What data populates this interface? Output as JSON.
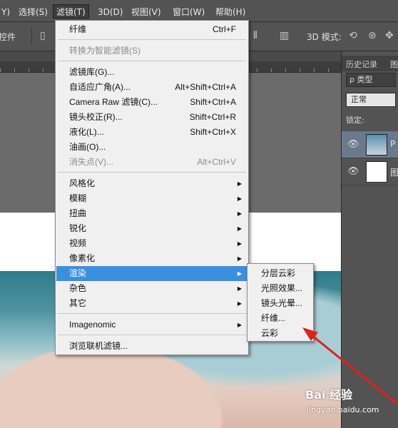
{
  "menubar": {
    "items": [
      "Y)",
      "选择(S)",
      "滤镜(T)",
      "3D(D)",
      "视图(V)",
      "窗口(W)",
      "帮助(H)"
    ]
  },
  "optbar": {
    "controls_label": "控件",
    "mode_3d": "3D 模式:"
  },
  "panel": {
    "tabs": [
      "历史记录",
      "图"
    ],
    "kind": "ρ 类型",
    "blend": "正常",
    "lock": "锁定:",
    "layers": [
      "P",
      "图"
    ]
  },
  "menu": {
    "items": [
      {
        "label": "纤维",
        "shortcut": "Ctrl+F"
      },
      {
        "label": "转换为智能滤镜(S)"
      },
      {
        "label": "滤镜库(G)..."
      },
      {
        "label": "自适应广角(A)...",
        "shortcut": "Alt+Shift+Ctrl+A"
      },
      {
        "label": "Camera Raw 滤镜(C)...",
        "shortcut": "Shift+Ctrl+A"
      },
      {
        "label": "镜头校正(R)...",
        "shortcut": "Shift+Ctrl+R"
      },
      {
        "label": "液化(L)...",
        "shortcut": "Shift+Ctrl+X"
      },
      {
        "label": "油画(O)..."
      },
      {
        "label": "消失点(V)...",
        "shortcut": "Alt+Ctrl+V"
      },
      {
        "label": "风格化"
      },
      {
        "label": "模糊"
      },
      {
        "label": "扭曲"
      },
      {
        "label": "锐化"
      },
      {
        "label": "视频"
      },
      {
        "label": "像素化"
      },
      {
        "label": "渲染"
      },
      {
        "label": "杂色"
      },
      {
        "label": "其它"
      },
      {
        "label": "Imagenomic"
      },
      {
        "label": "浏览联机滤镜..."
      }
    ]
  },
  "submenu": {
    "items": [
      "分层云彩",
      "光照效果...",
      "镜头光晕...",
      "纤维...",
      "云彩"
    ]
  },
  "watermark": {
    "brand": "Bai 经验",
    "url": "jingyan.baidu.com"
  },
  "colors": {
    "highlight": "#3b8fe0",
    "arrow": "#e02020"
  }
}
